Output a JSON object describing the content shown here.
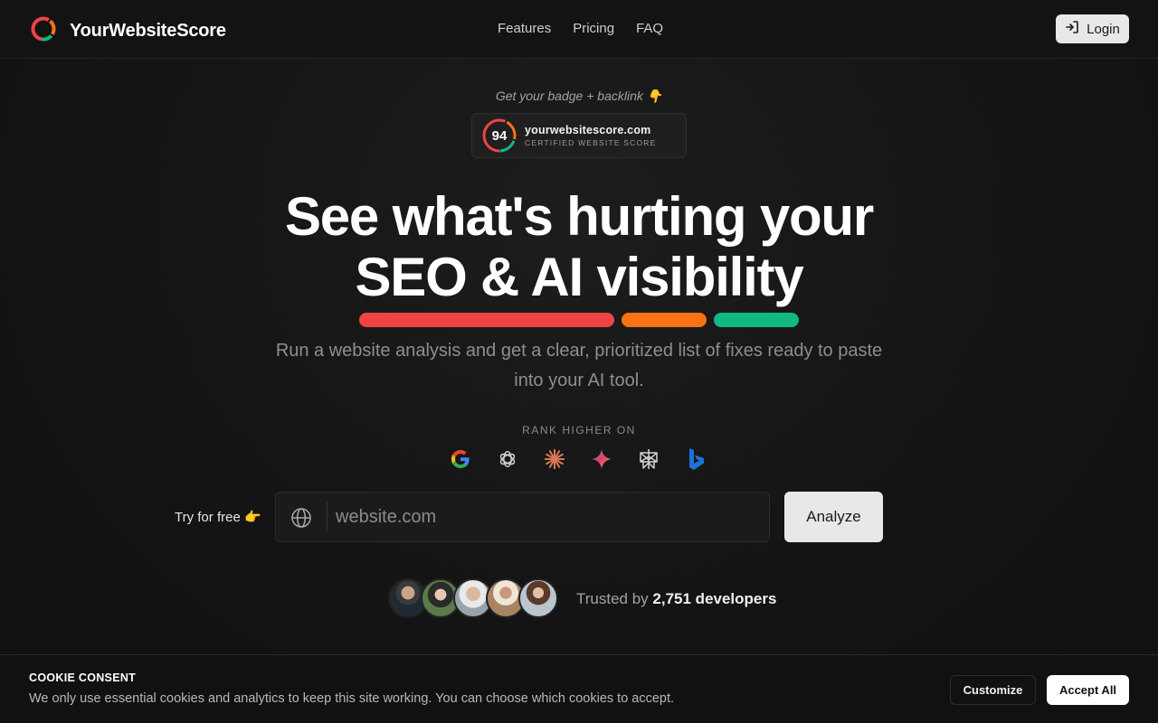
{
  "header": {
    "brand": "YourWebsiteScore",
    "nav": [
      "Features",
      "Pricing",
      "FAQ"
    ],
    "login_label": "Login"
  },
  "badge": {
    "caption": "Get your badge + backlink 👇",
    "score": "94",
    "domain": "yourwebsitescore.com",
    "subtitle": "CERTIFIED WEBSITE SCORE"
  },
  "hero": {
    "headline_line1": "See what's hurting your",
    "headline_line2": "SEO & AI visibility",
    "subtitle": "Run a website analysis and get a clear, prioritized list of fixes ready to paste into your AI tool.",
    "rank_label": "RANK HIGHER ON",
    "engines": [
      "google-icon",
      "chatgpt-icon",
      "claude-icon",
      "gemini-icon",
      "perplexity-icon",
      "bing-icon"
    ],
    "bar_colors": [
      "#ef4444",
      "#f97316",
      "#10b981"
    ]
  },
  "search": {
    "try_label": "Try for free 👉",
    "placeholder": "website.com",
    "value": "",
    "button_label": "Analyze"
  },
  "social_proof": {
    "prefix": "Trusted by",
    "count": "2,751 developers"
  },
  "cookie": {
    "title": "COOKIE CONSENT",
    "text": "We only use essential cookies and analytics to keep this site working. You can choose which cookies to accept.",
    "customize_label": "Customize",
    "accept_label": "Accept All"
  }
}
